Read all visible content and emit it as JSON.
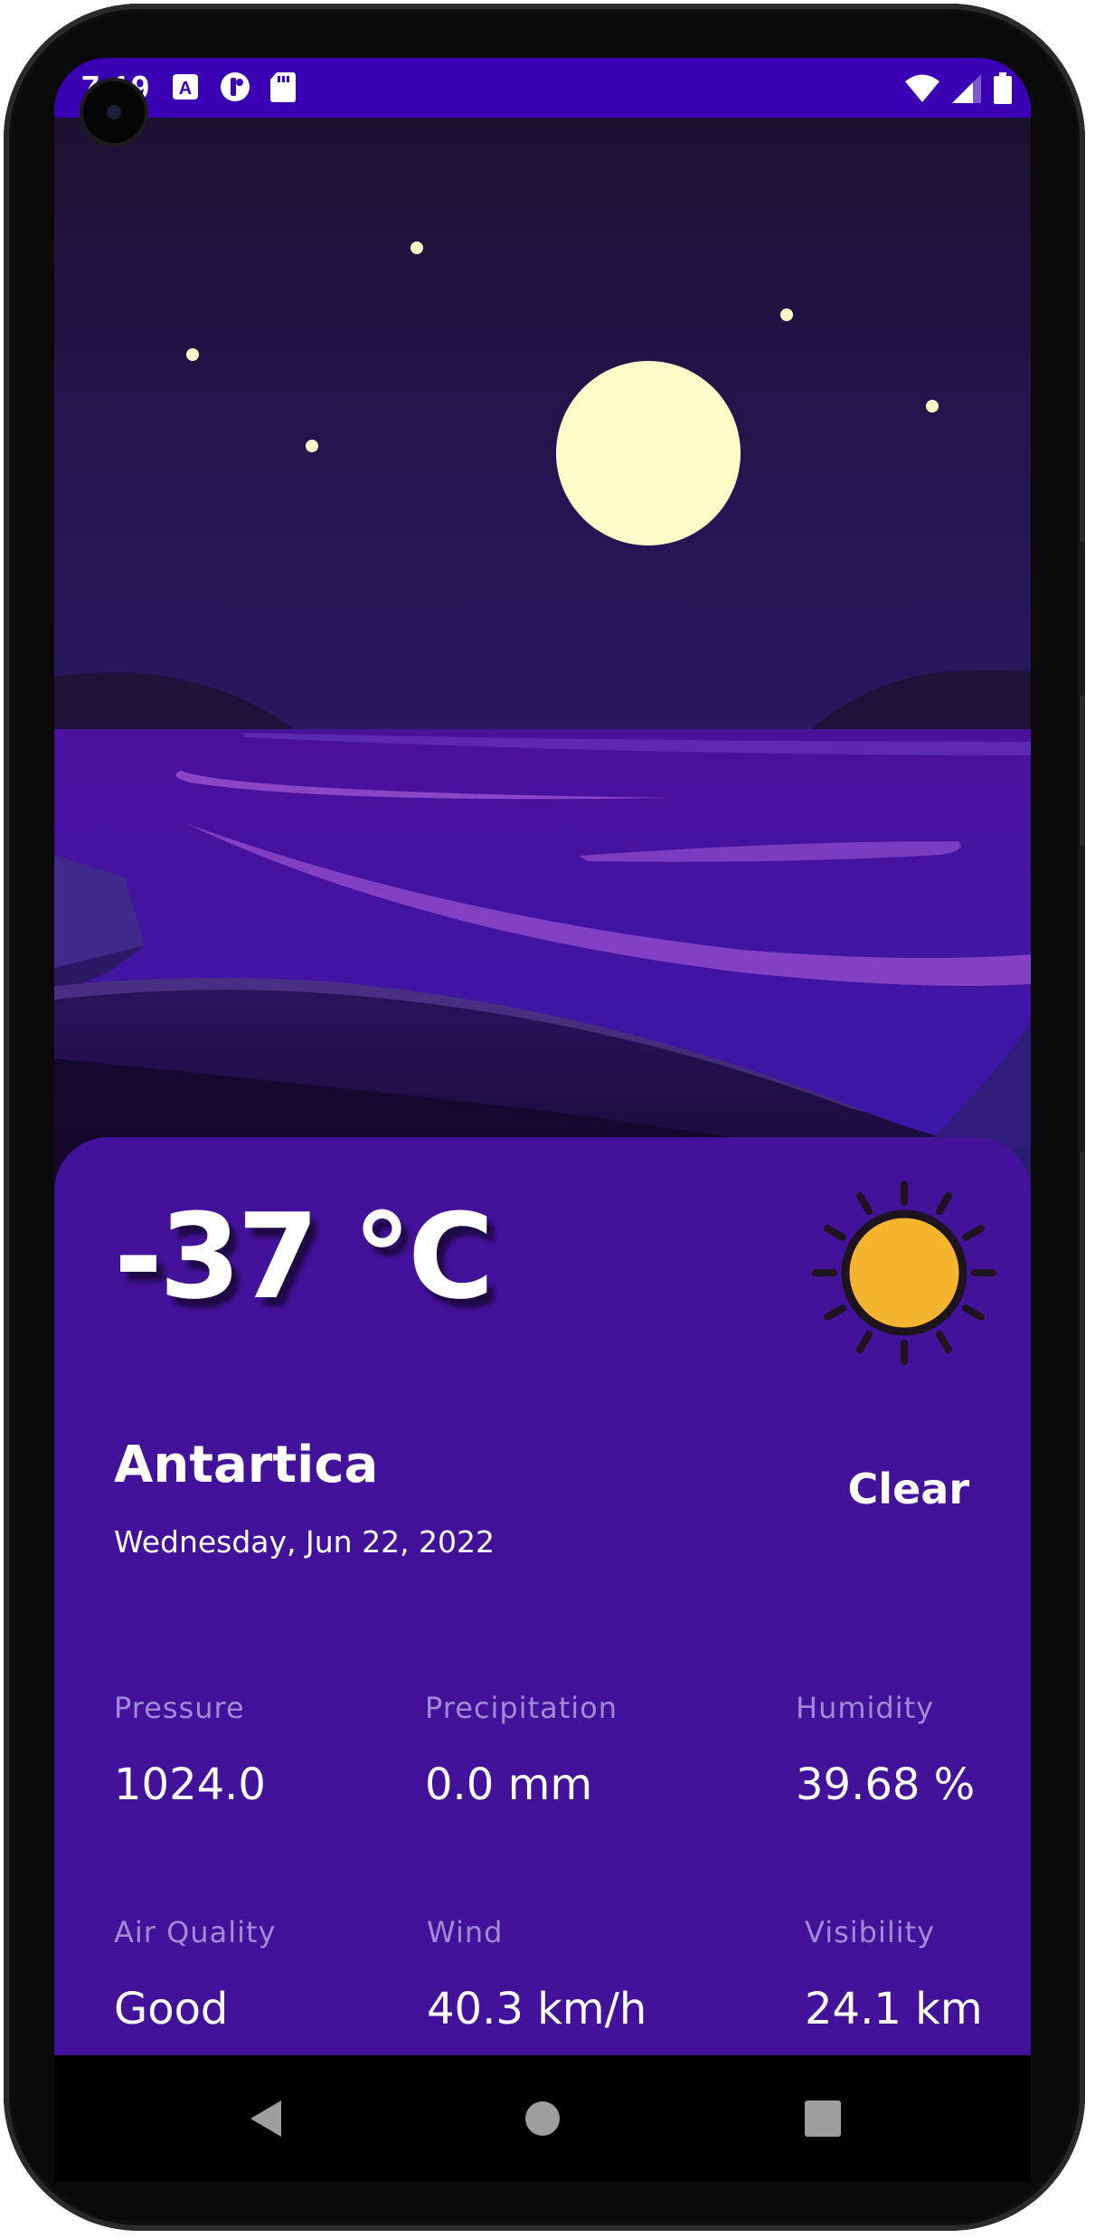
{
  "status_bar": {
    "time": "7:19",
    "notification_icons": [
      "text-a-icon",
      "app-circle-icon",
      "sd-card-icon"
    ],
    "system_icons": [
      "wifi-icon",
      "cell-signal-icon",
      "battery-icon"
    ]
  },
  "weather": {
    "temperature": "-37 °C",
    "location": "Antartica",
    "date": "Wednesday, Jun 22, 2022",
    "condition": "Clear",
    "condition_icon": "sun-icon"
  },
  "stats": [
    {
      "label": "Pressure",
      "value": "1024.0"
    },
    {
      "label": "Precipitation",
      "value": "0.0 mm"
    },
    {
      "label": "Humidity",
      "value": "39.68 %"
    },
    {
      "label": "Air Quality",
      "value": "Good"
    },
    {
      "label": "Wind",
      "value": "40.3 km/h"
    },
    {
      "label": "Visibility",
      "value": "24.1 km"
    }
  ],
  "navigation": {
    "back": "back-icon",
    "home": "home-icon",
    "recents": "recents-icon"
  },
  "colors": {
    "status_bar": "#3a00b4",
    "card": "#43129a",
    "sky_top": "#1b1130",
    "sky_bottom": "#2a1b6e",
    "water": "#4a16a4",
    "moon": "#fdfbc7",
    "sun": "#f5b52f",
    "label": "#a38ad6"
  }
}
